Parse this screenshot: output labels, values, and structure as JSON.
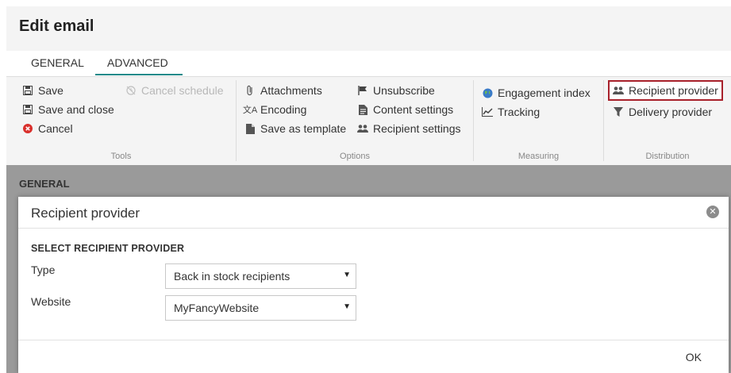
{
  "header": {
    "title": "Edit email"
  },
  "tabs": [
    {
      "label": "GENERAL"
    },
    {
      "label": "ADVANCED"
    }
  ],
  "ribbon": {
    "tools": {
      "label": "Tools",
      "save": "Save",
      "save_close": "Save and close",
      "cancel": "Cancel",
      "cancel_schedule": "Cancel schedule"
    },
    "options": {
      "label": "Options",
      "attachments": "Attachments",
      "encoding": "Encoding",
      "save_template": "Save as template",
      "unsubscribe": "Unsubscribe",
      "content_settings": "Content settings",
      "recipient_settings": "Recipient settings"
    },
    "measuring": {
      "label": "Measuring",
      "engagement": "Engagement index",
      "tracking": "Tracking"
    },
    "distribution": {
      "label": "Distribution",
      "recipient_provider": "Recipient provider",
      "delivery_provider": "Delivery provider"
    }
  },
  "background": {
    "section_title": "GENERAL"
  },
  "modal": {
    "title": "Recipient provider",
    "section": "SELECT RECIPIENT PROVIDER",
    "type_label": "Type",
    "type_value": "Back in stock recipients",
    "website_label": "Website",
    "website_value": "MyFancyWebsite",
    "ok": "OK"
  },
  "colors": {
    "accent": "#1f8a8a",
    "highlight_border": "#a8212b",
    "cancel_icon": "#d9302c",
    "overlay": "#9a9a9a"
  }
}
